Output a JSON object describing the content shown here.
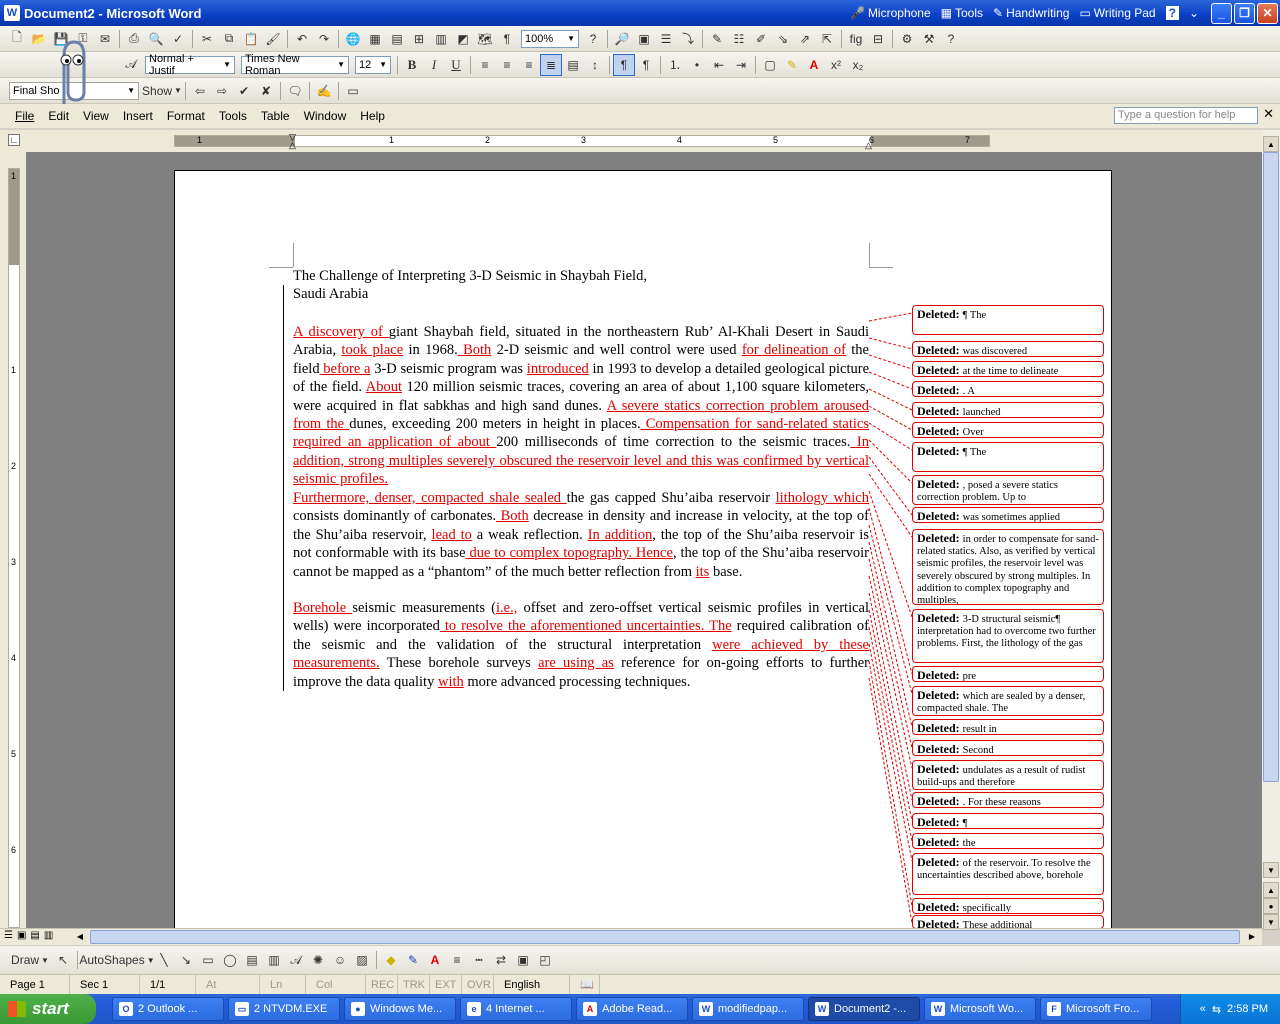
{
  "window": {
    "title": "Document2 - Microsoft Word",
    "app_icon": "W",
    "lang_bar": {
      "microphone": "Microphone",
      "tools": "Tools",
      "handwriting": "Handwriting",
      "writing_pad": "Writing Pad",
      "help": "?"
    }
  },
  "toolbar_std": {
    "zoom": "100%"
  },
  "toolbar_fmt": {
    "style": "Normal + Justif",
    "font": "Times New Roman",
    "size": "12",
    "bold": "B",
    "italic": "I",
    "underline": "U"
  },
  "toolbar_review": {
    "display": "Final Sho",
    "show": "Show"
  },
  "menu": {
    "items": [
      "File",
      "Edit",
      "View",
      "Insert",
      "Format",
      "Tools",
      "Table",
      "Window",
      "Help"
    ],
    "ask_placeholder": "Type a question for help"
  },
  "ruler": {
    "numbers": [
      "1",
      "1",
      "2",
      "3",
      "4",
      "5",
      "6",
      "7"
    ],
    "vnumbers": [
      "1",
      "1",
      "2",
      "3",
      "4",
      "5",
      "6"
    ]
  },
  "document": {
    "title_line1": "The Challenge of Interpreting 3-D Seismic in Shaybah Field,",
    "title_line2": "Saudi Arabia",
    "p1": [
      {
        "t": " A discovery of ",
        "ins": true
      },
      {
        "t": "giant Shaybah field, situated in the northeastern Rub’ Al-Khali Desert in Saudi Arabia, ",
        "ins": false
      },
      {
        "t": "took place",
        "ins": true
      },
      {
        "t": " in 1968.",
        "ins": false
      },
      {
        "t": " Both",
        "ins": true
      },
      {
        "t": " 2-D seismic and well control were used ",
        "ins": false
      },
      {
        "t": "for delineation of",
        "ins": true
      },
      {
        "t": " the field",
        "ins": false
      },
      {
        "t": " before a",
        "ins": true
      },
      {
        "t": " 3-D seismic program was ",
        "ins": false
      },
      {
        "t": "introduced",
        "ins": true
      },
      {
        "t": " in 1993 to develop a detailed geological picture of the field. ",
        "ins": false
      },
      {
        "t": "About",
        "ins": true
      },
      {
        "t": " 120 million seismic traces, covering an area of about 1,100 square kilometers, were acquired in flat sabkhas and high sand dunes. ",
        "ins": false
      },
      {
        "t": "A severe statics correction problem aroused from the ",
        "ins": true
      },
      {
        "t": "dunes, exceeding 200 meters in height in places.",
        "ins": false
      },
      {
        "t": " Compensation for sand-related statics required an application of about ",
        "ins": true
      },
      {
        "t": "200 milliseconds of time correction to the seismic traces.",
        "ins": false
      },
      {
        "t": " In addition, strong multiples severely obscured the reservoir level and this was confirmed by vertical seismic profiles.",
        "ins": true
      }
    ],
    "p2": [
      {
        "t": " Furthermore, denser, compacted shale sealed ",
        "ins": true
      },
      {
        "t": "the ",
        "ins": false
      },
      {
        "t": "gas",
        "ins": false
      },
      {
        "t": " capped Shu’aiba reservoir ",
        "ins": false
      },
      {
        "t": "lithology which ",
        "ins": true
      },
      {
        "t": "consists dominantly of carbonates.",
        "ins": false
      },
      {
        "t": " Both",
        "ins": true
      },
      {
        "t": " decrease in density and increase in velocity, at the top of the Shu’aiba reservoir, ",
        "ins": false
      },
      {
        "t": "lead to",
        "ins": true
      },
      {
        "t": " a weak reflection. ",
        "ins": false
      },
      {
        "t": "In addition",
        "ins": true
      },
      {
        "t": ", the top of the Shu’aiba reservoir is not conformable with its base",
        "ins": false
      },
      {
        "t": " due to complex topography. Hence",
        "ins": true
      },
      {
        "t": ", the top of the Shu’aiba reservoir cannot be mapped as a “phantom” of the much better reflection from ",
        "ins": false
      },
      {
        "t": "its",
        "ins": true
      },
      {
        "t": " base.",
        "ins": false
      }
    ],
    "p3": [
      {
        "t": " Borehole ",
        "ins": true
      },
      {
        "t": "seismic measurements (",
        "ins": false
      },
      {
        "t": "i.e.,",
        "ins": true
      },
      {
        "t": " offset and zero-offset vertical seismic profiles in vertical wells) were incorporated",
        "ins": false
      },
      {
        "t": " to resolve the aforementioned uncertainties. The",
        "ins": true
      },
      {
        "t": " required calibration of the seismic and the validation of the structural interpretation ",
        "ins": false
      },
      {
        "t": "were achieved by these measurements.",
        "ins": true
      },
      {
        "t": " These borehole surveys ",
        "ins": false
      },
      {
        "t": "are using as",
        "ins": true
      },
      {
        "t": " reference for on-going efforts to further improve the data quality ",
        "ins": false
      },
      {
        "t": "with",
        "ins": true
      },
      {
        "t": " more advanced processing techniques.",
        "ins": false
      }
    ]
  },
  "balloons": [
    {
      "label": "Deleted:",
      "text": "¶ The"
    },
    {
      "label": "Deleted:",
      "text": "was discovered"
    },
    {
      "label": "Deleted:",
      "text": "at the time to delineate"
    },
    {
      "label": "Deleted:",
      "text": ". A"
    },
    {
      "label": "Deleted:",
      "text": "launched"
    },
    {
      "label": "Deleted:",
      "text": "Over"
    },
    {
      "label": "Deleted:",
      "text": "¶ The"
    },
    {
      "label": "Deleted:",
      "text": ", posed a severe statics correction problem. Up to"
    },
    {
      "label": "Deleted:",
      "text": "was sometimes applied"
    },
    {
      "label": "Deleted:",
      "text": "in order to compensate for sand-related statics. Also, as verified by vertical seismic profiles, the reservoir level was severely obscured by strong multiples. In addition to complex topography and multiples,"
    },
    {
      "label": "Deleted:",
      "text": "3-D structural seismic¶ interpretation had to overcome two further problems. First, the lithology of the gas"
    },
    {
      "label": "Deleted:",
      "text": "pre"
    },
    {
      "label": "Deleted:",
      "text": "which are sealed by a denser, compacted shale. The"
    },
    {
      "label": "Deleted:",
      "text": "result in"
    },
    {
      "label": "Deleted:",
      "text": "Second"
    },
    {
      "label": "Deleted:",
      "text": "undulates as a result of rudist build-ups and therefore"
    },
    {
      "label": "Deleted:",
      "text": ". For these reasons"
    },
    {
      "label": "Deleted:",
      "text": "¶"
    },
    {
      "label": "Deleted:",
      "text": "the"
    },
    {
      "label": "Deleted:",
      "text": "of the reservoir. To resolve the uncertainties described above, borehole"
    },
    {
      "label": "Deleted:",
      "text": "specifically"
    },
    {
      "label": "Deleted:",
      "text": "These additional"
    }
  ],
  "drawbar": {
    "draw": "Draw",
    "autoshapes": "AutoShapes"
  },
  "status": {
    "page": "Page  1",
    "sec": "Sec  1",
    "pages": "1/1",
    "at": "At",
    "ln": "Ln",
    "col": "Col",
    "rec": "REC",
    "trk": "TRK",
    "ext": "EXT",
    "ovr": "OVR",
    "lang": "English (U.S"
  },
  "taskbar": {
    "start": "start",
    "tasks": [
      {
        "label": "2 Outlook ...",
        "active": false
      },
      {
        "label": "2 NTVDM.EXE",
        "active": false
      },
      {
        "label": "Windows Me...",
        "active": false
      },
      {
        "label": "4 Internet ...",
        "active": false
      },
      {
        "label": "Adobe Read...",
        "active": false
      },
      {
        "label": "modifiedpap...",
        "active": false
      },
      {
        "label": "Document2 -...",
        "active": true
      },
      {
        "label": "Microsoft Wo...",
        "active": false
      },
      {
        "label": "Microsoft Fro...",
        "active": false
      }
    ],
    "clock": "2:58 PM"
  },
  "colors": {
    "revision": "#e00000",
    "titlebar": "#0a3fc4",
    "taskbar": "#245edb"
  }
}
